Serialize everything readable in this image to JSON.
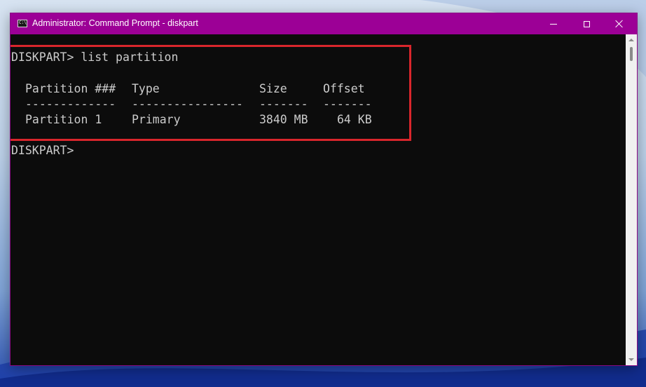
{
  "window": {
    "title": "Administrator: Command Prompt - diskpart",
    "icon": "cmd-icon",
    "controls": [
      "minimize",
      "maximize",
      "close"
    ],
    "titlebar_color": "#9c0096"
  },
  "console": {
    "command_line": "DISKPART> list partition",
    "table": {
      "headers": [
        "Partition ###",
        "Type",
        "Size",
        "Offset"
      ],
      "separators": [
        "-------------",
        "----------------",
        "-------",
        "-------"
      ],
      "rows": [
        [
          "Partition 1",
          "Primary",
          "3840 MB",
          "64 KB"
        ]
      ]
    },
    "prompt": "DISKPART> ",
    "highlight_color": "#d9262c"
  }
}
